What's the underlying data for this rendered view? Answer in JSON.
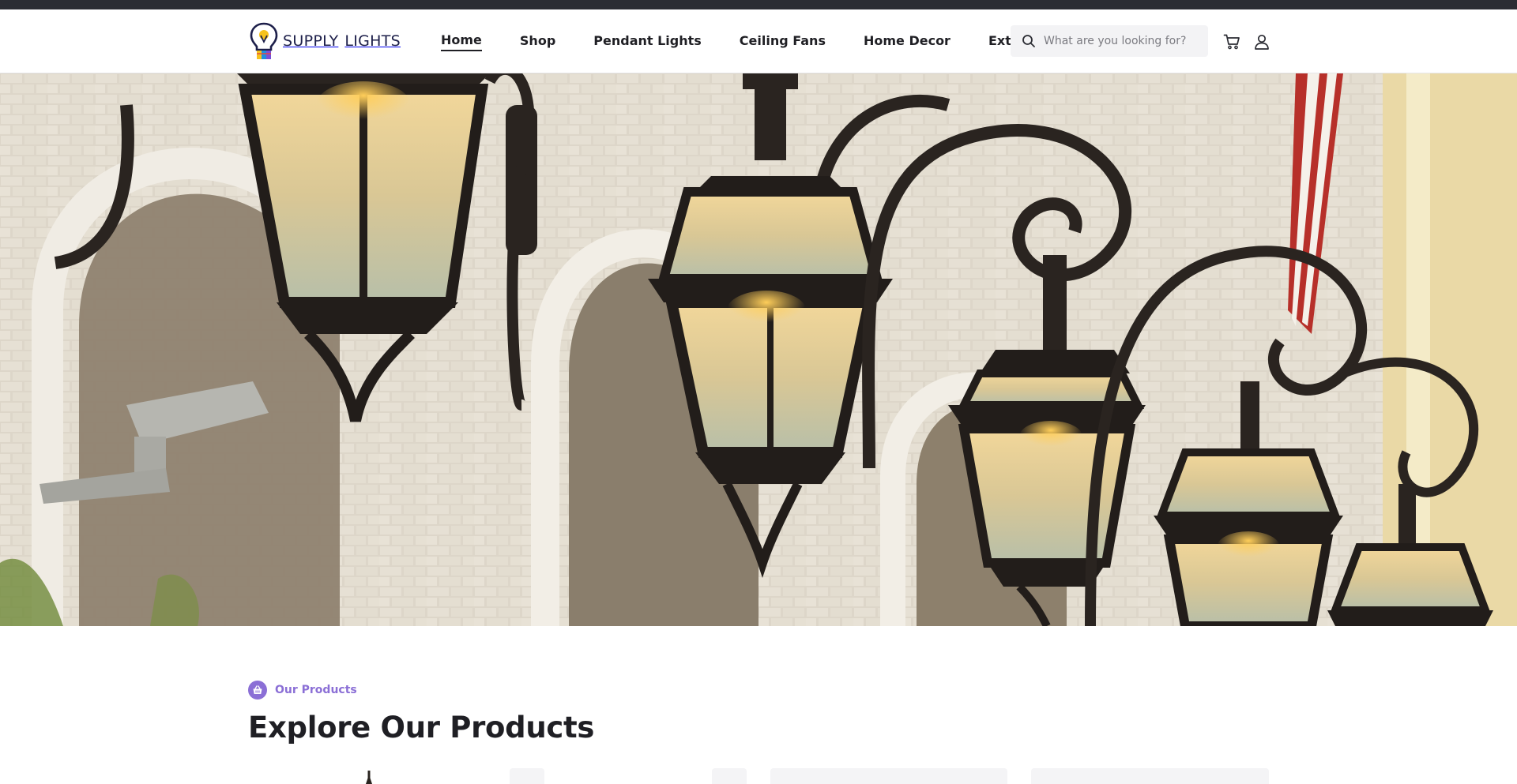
{
  "brand": {
    "name_part1": "SUPPLY",
    "name_part2": "LIGHTS",
    "logo_colors": [
      "#1d1f4a",
      "#f6c21c",
      "#e8473c",
      "#1f8fe0",
      "#7a4fd6"
    ]
  },
  "nav": {
    "items": [
      {
        "label": "Home",
        "active": true
      },
      {
        "label": "Shop",
        "active": false
      },
      {
        "label": "Pendant Lights",
        "active": false
      },
      {
        "label": "Ceiling Fans",
        "active": false
      },
      {
        "label": "Home Decor",
        "active": false
      },
      {
        "label": "Exterior",
        "active": false
      }
    ]
  },
  "search": {
    "placeholder": "What are you looking for?",
    "value": "",
    "icon": "search-icon"
  },
  "header_icons": {
    "cart": "cart-icon",
    "account": "user-icon"
  },
  "hero": {
    "image": "lantern-street-lamps-photo"
  },
  "products_section": {
    "eyebrow": "Our Products",
    "eyebrow_icon": "basket-icon",
    "title": "Explore Our Products"
  },
  "colors": {
    "accent": "#8b6fd6",
    "text": "#1f1f24",
    "topbar": "#2b2c33",
    "search_bg": "#f3f3f5"
  }
}
